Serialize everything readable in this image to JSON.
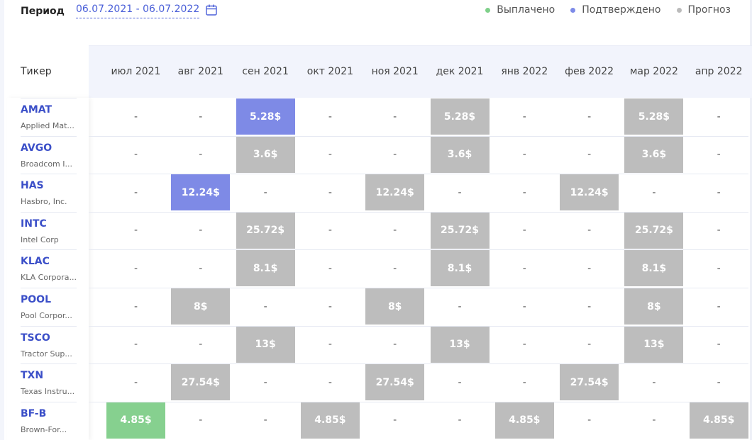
{
  "header": {
    "period_label": "Период",
    "period_value": "06.07.2021 - 06.07.2022"
  },
  "legend": [
    {
      "label": "Выплачено",
      "color": "#7fd08a"
    },
    {
      "label": "Подтверждено",
      "color": "#7d8be8"
    },
    {
      "label": "Прогноз",
      "color": "#bbbbbb"
    }
  ],
  "colors": {
    "paid": "#86d08f",
    "confirmed": "#7e8ae6",
    "forecast": "#bdbdbd",
    "accent": "#3b4fc8"
  },
  "table": {
    "ticker_header": "Тикер",
    "months": [
      "июл 2021",
      "авг 2021",
      "сен 2021",
      "окт 2021",
      "ноя 2021",
      "дек 2021",
      "янв 2022",
      "фев 2022",
      "мар 2022",
      "апр 2022"
    ],
    "rows": [
      {
        "symbol": "AMAT",
        "name": "Applied Mat...",
        "cells": [
          "-",
          "-",
          {
            "v": "5.28$",
            "s": "confirmed"
          },
          "-",
          "-",
          {
            "v": "5.28$",
            "s": "forecast"
          },
          "-",
          "-",
          {
            "v": "5.28$",
            "s": "forecast"
          },
          "-"
        ]
      },
      {
        "symbol": "AVGO",
        "name": "Broadcom I...",
        "cells": [
          "-",
          "-",
          {
            "v": "3.6$",
            "s": "forecast"
          },
          "-",
          "-",
          {
            "v": "3.6$",
            "s": "forecast"
          },
          "-",
          "-",
          {
            "v": "3.6$",
            "s": "forecast"
          },
          "-"
        ]
      },
      {
        "symbol": "HAS",
        "name": "Hasbro, Inc.",
        "cells": [
          "-",
          {
            "v": "12.24$",
            "s": "confirmed"
          },
          "-",
          "-",
          {
            "v": "12.24$",
            "s": "forecast"
          },
          "-",
          "-",
          {
            "v": "12.24$",
            "s": "forecast"
          },
          "-",
          "-"
        ]
      },
      {
        "symbol": "INTC",
        "name": "Intel Corp",
        "cells": [
          "-",
          "-",
          {
            "v": "25.72$",
            "s": "forecast"
          },
          "-",
          "-",
          {
            "v": "25.72$",
            "s": "forecast"
          },
          "-",
          "-",
          {
            "v": "25.72$",
            "s": "forecast"
          },
          "-"
        ]
      },
      {
        "symbol": "KLAC",
        "name": "KLA Corpora...",
        "cells": [
          "-",
          "-",
          {
            "v": "8.1$",
            "s": "forecast"
          },
          "-",
          "-",
          {
            "v": "8.1$",
            "s": "forecast"
          },
          "-",
          "-",
          {
            "v": "8.1$",
            "s": "forecast"
          },
          "-"
        ]
      },
      {
        "symbol": "POOL",
        "name": "Pool Corpor...",
        "cells": [
          "-",
          {
            "v": "8$",
            "s": "forecast"
          },
          "-",
          "-",
          {
            "v": "8$",
            "s": "forecast"
          },
          "-",
          "-",
          "-",
          {
            "v": "8$",
            "s": "forecast"
          },
          "-"
        ]
      },
      {
        "symbol": "TSCO",
        "name": "Tractor Sup...",
        "cells": [
          "-",
          "-",
          {
            "v": "13$",
            "s": "forecast"
          },
          "-",
          "-",
          {
            "v": "13$",
            "s": "forecast"
          },
          "-",
          "-",
          {
            "v": "13$",
            "s": "forecast"
          },
          "-"
        ]
      },
      {
        "symbol": "TXN",
        "name": "Texas Instru...",
        "cells": [
          "-",
          {
            "v": "27.54$",
            "s": "forecast"
          },
          "-",
          "-",
          {
            "v": "27.54$",
            "s": "forecast"
          },
          "-",
          "-",
          {
            "v": "27.54$",
            "s": "forecast"
          },
          "-",
          "-"
        ]
      },
      {
        "symbol": "BF-B",
        "name": "Brown-For...",
        "cells": [
          {
            "v": "4.85$",
            "s": "paid"
          },
          "-",
          "-",
          {
            "v": "4.85$",
            "s": "forecast"
          },
          "-",
          "-",
          {
            "v": "4.85$",
            "s": "forecast"
          },
          "-",
          "-",
          {
            "v": "4.85$",
            "s": "forecast"
          }
        ]
      }
    ]
  }
}
